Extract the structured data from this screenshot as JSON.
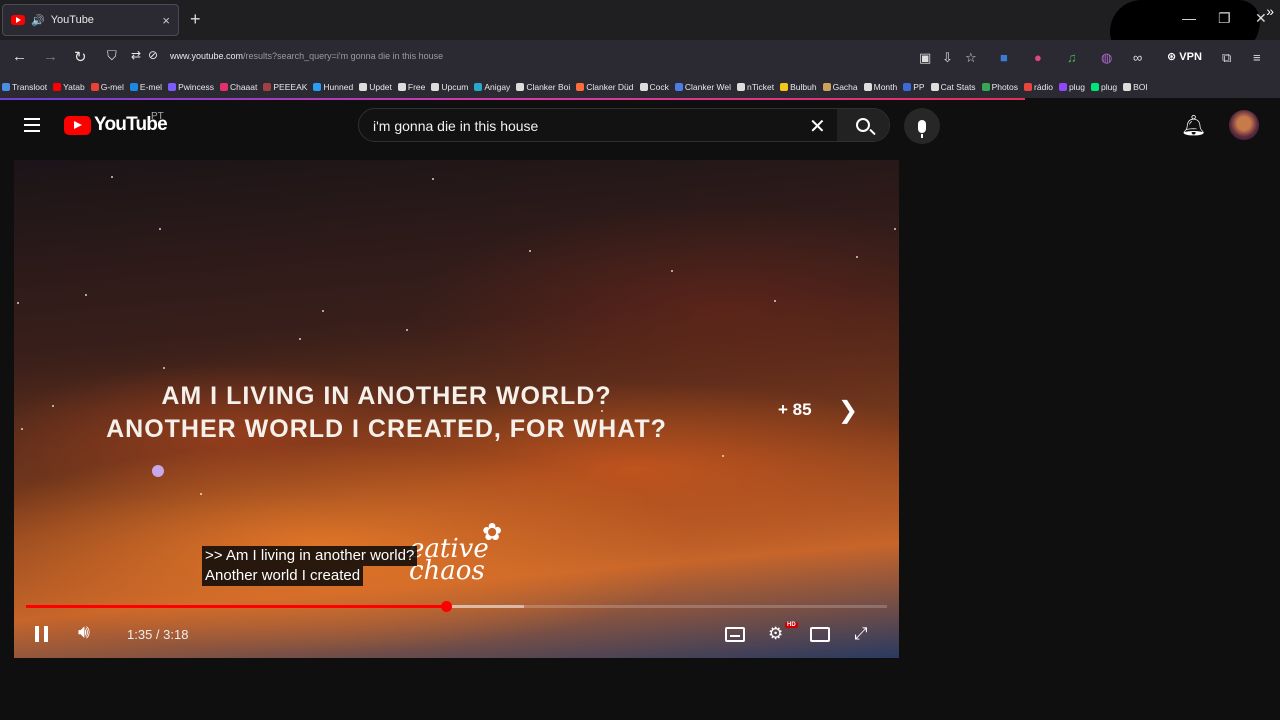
{
  "browser": {
    "tab": {
      "title": "YouTube",
      "close_label": "×"
    },
    "new_tab_label": "+",
    "window_controls": {
      "minimize": "—",
      "maximize": "❐",
      "close": "✕"
    },
    "nav": {
      "back": "←",
      "forward": "→",
      "reload": "↻"
    },
    "url": {
      "domain": "www.youtube.com",
      "path": "/results?search_query=i'm gonna die in this house"
    },
    "vpn_label": "VPN",
    "bookmarks": [
      {
        "label": "Transloot",
        "color": "#4a90e2"
      },
      {
        "label": "Yatab",
        "color": "#ff0000"
      },
      {
        "label": "G-mel",
        "color": "#ea4335"
      },
      {
        "label": "E-mel",
        "color": "#1e88e5"
      },
      {
        "label": "Pwincess",
        "color": "#7b5cff"
      },
      {
        "label": "Chaaat",
        "color": "#e1306c"
      },
      {
        "label": "PEEEAK",
        "color": "#a04040"
      },
      {
        "label": "Hunned",
        "color": "#2a9df4"
      },
      {
        "label": "Updet",
        "color": "#dddddd"
      },
      {
        "label": "Free",
        "color": "#dddddd"
      },
      {
        "label": "Upcum",
        "color": "#dddddd"
      },
      {
        "label": "Anigay",
        "color": "#2aa6c8"
      },
      {
        "label": "Clanker Boi",
        "color": "#dddddd"
      },
      {
        "label": "Clanker Düd",
        "color": "#ff6b3d"
      },
      {
        "label": "Cock",
        "color": "#dddddd"
      },
      {
        "label": "Clanker Wel",
        "color": "#4a7de8"
      },
      {
        "label": "nTicket",
        "color": "#dddddd"
      },
      {
        "label": "Bulbuh",
        "color": "#f5c518"
      },
      {
        "label": "Gacha",
        "color": "#c9a35a"
      },
      {
        "label": "Month",
        "color": "#dddddd"
      },
      {
        "label": "PP",
        "color": "#3a6bd8"
      },
      {
        "label": "Cat Stats",
        "color": "#dddddd"
      },
      {
        "label": "Photos",
        "color": "#34a853"
      },
      {
        "label": "rádio",
        "color": "#e8453c"
      },
      {
        "label": "plug",
        "color": "#9146ff"
      },
      {
        "label": "plug",
        "color": "#00e676"
      },
      {
        "label": "BOI",
        "color": "#dddddd"
      }
    ],
    "bookmarks_overflow": "»"
  },
  "youtube": {
    "logo_text": "YouTube",
    "region": "PT",
    "search": {
      "query": "i'm gonna die in this house",
      "clear": "✕"
    },
    "notifications_icon": "bell-icon"
  },
  "player": {
    "video_lines": [
      "AM I LIVING IN ANOTHER WORLD?",
      "ANOTHER WORLD I CREATED, FOR WHAT?"
    ],
    "more_count": "+ 85",
    "watermark": {
      "line1": "eative",
      "line2": "chaos"
    },
    "captions": [
      ">> Am I living in another world?",
      "Another world I created"
    ],
    "time": "1:35 / 3:18",
    "progress": {
      "played": 0.488,
      "buffered": 0.578
    },
    "hd_badge": "HD",
    "colors": {
      "accent": "#ff0000"
    }
  }
}
